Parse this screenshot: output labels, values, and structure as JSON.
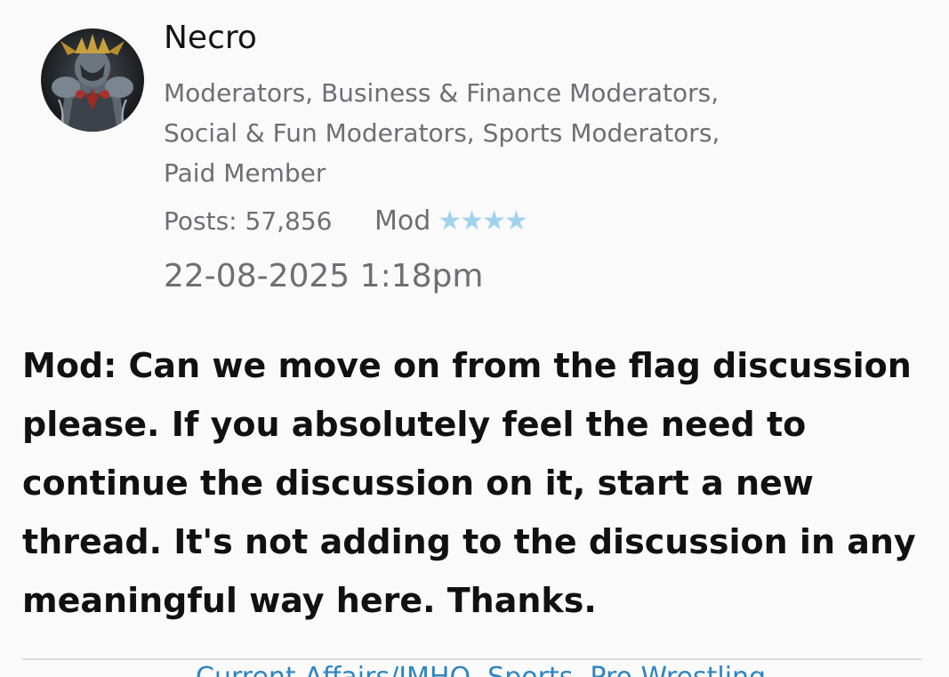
{
  "post": {
    "author": {
      "username": "Necro",
      "groups": "Moderators, Business & Finance Moderators, Social & Fun Moderators, Sports Moderators, Paid Member",
      "posts": "Posts: 57,856",
      "rank_label": "Mod",
      "rank_stars": "★★★★"
    },
    "date": "22-08-2025 1:18pm",
    "body": "Mod: Can we move on from the flag discussion please. If you absolutely feel the need to continue the discussion on it, start a new thread. It's not adding to the discussion in any meaningful way here. Thanks."
  },
  "next_link": "Current Affairs/IMHO, Sports, Pro Wrestling",
  "colors": {
    "link": "#2e86c1",
    "stars": "#9fd3ee",
    "muted_text": "#6e6e73"
  }
}
